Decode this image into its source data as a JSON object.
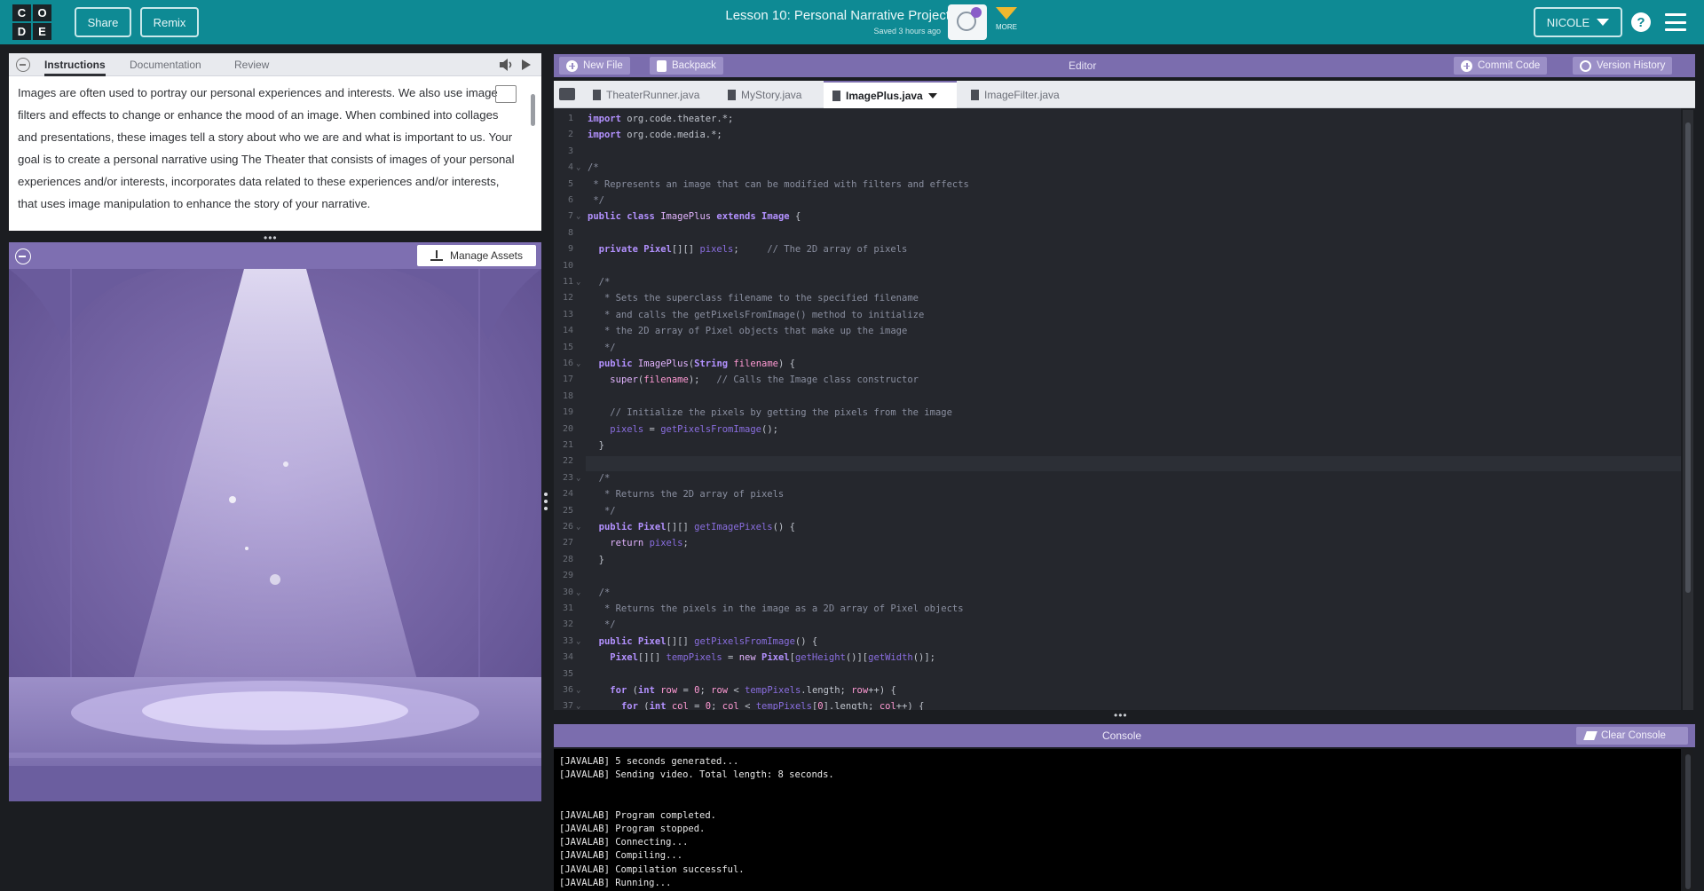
{
  "topbar": {
    "logo_letters": [
      "C",
      "O",
      "D",
      "E"
    ],
    "share_label": "Share",
    "remix_label": "Remix",
    "lesson_title": "Lesson 10: Personal Narrative Project",
    "saved_status": "Saved 3 hours ago",
    "more_label": "MORE",
    "user_name": "NICOLE",
    "help_label": "?"
  },
  "instructions": {
    "tabs": [
      "Instructions",
      "Documentation",
      "Review"
    ],
    "active_tab": "Instructions",
    "text": "Images are often used to portray our personal experiences and interests. We also use image filters and effects to change or enhance the mood of an image. When combined into collages and presentations, these images tell a story about who we are and what is important to us. Your goal is to create a personal narrative using The Theater that consists of images of your personal experiences and/or interests, incorporates data related to these experiences and/or interests, that uses image manipulation to enhance the story of your narrative."
  },
  "theater": {
    "manage_assets_label": "Manage Assets"
  },
  "editor": {
    "new_file_label": "New File",
    "backpack_label": "Backpack",
    "title": "Editor",
    "commit_label": "Commit Code",
    "version_history_label": "Version History",
    "file_tabs": [
      "TheaterRunner.java",
      "MyStory.java",
      "ImagePlus.java",
      "ImageFilter.java"
    ],
    "active_file": "ImagePlus.java",
    "lines": [
      {
        "n": "1",
        "fold": "",
        "html": "<span class='kw'>import</span> org.code.theater.*;"
      },
      {
        "n": "2",
        "fold": "",
        "html": "<span class='kw'>import</span> org.code.media.*;"
      },
      {
        "n": "3",
        "fold": "",
        "html": ""
      },
      {
        "n": "4",
        "fold": "⌄",
        "html": "<span class='cm'>/*</span>"
      },
      {
        "n": "5",
        "fold": "",
        "html": "<span class='cm'> * Represents an image that can be modified with filters and effects</span>"
      },
      {
        "n": "6",
        "fold": "",
        "html": "<span class='cm'> */</span>"
      },
      {
        "n": "7",
        "fold": "⌄",
        "html": "<span class='kw'>public class</span> <span class='ty'>ImagePlus</span> <span class='kw'>extends</span> <span class='kw'>Image</span> {"
      },
      {
        "n": "8",
        "fold": "",
        "html": ""
      },
      {
        "n": "9",
        "fold": "",
        "html": "  <span class='kw'>private Pixel</span>[][] <span class='fn'>pixels</span>;     <span class='cm'>// The 2D array of pixels</span>"
      },
      {
        "n": "10",
        "fold": "",
        "html": ""
      },
      {
        "n": "11",
        "fold": "⌄",
        "html": "  <span class='cm'>/*</span>"
      },
      {
        "n": "12",
        "fold": "",
        "html": "<span class='cm'>   * Sets the superclass filename to the specified filename</span>"
      },
      {
        "n": "13",
        "fold": "",
        "html": "<span class='cm'>   * and calls the getPixelsFromImage() method to initialize</span>"
      },
      {
        "n": "14",
        "fold": "",
        "html": "<span class='cm'>   * the 2D array of Pixel objects that make up the image</span>"
      },
      {
        "n": "15",
        "fold": "",
        "html": "<span class='cm'>   */</span>"
      },
      {
        "n": "16",
        "fold": "⌄",
        "html": "  <span class='kw'>public</span> <span class='ty'>ImagePlus</span>(<span class='kw'>String</span> <span class='st'>filename</span>) {"
      },
      {
        "n": "17",
        "fold": "",
        "html": "    <span class='ty'>super</span>(<span class='st'>filename</span>);   <span class='cm'>// Calls the Image class constructor</span>"
      },
      {
        "n": "18",
        "fold": "",
        "html": ""
      },
      {
        "n": "19",
        "fold": "",
        "html": "    <span class='cm'>// Initialize the pixels by getting the pixels from the image</span>"
      },
      {
        "n": "20",
        "fold": "",
        "html": "    <span class='fn'>pixels</span> = <span class='fn'>getPixelsFromImage</span>();"
      },
      {
        "n": "21",
        "fold": "",
        "html": "  }"
      },
      {
        "n": "22",
        "fold": "",
        "html": ""
      },
      {
        "n": "23",
        "fold": "⌄",
        "html": "  <span class='cm'>/*</span>"
      },
      {
        "n": "24",
        "fold": "",
        "html": "<span class='cm'>   * Returns the 2D array of pixels</span>"
      },
      {
        "n": "25",
        "fold": "",
        "html": "<span class='cm'>   */</span>"
      },
      {
        "n": "26",
        "fold": "⌄",
        "html": "  <span class='kw'>public Pixel</span>[][] <span class='fn'>getImagePixels</span>() {"
      },
      {
        "n": "27",
        "fold": "",
        "html": "    <span class='ty'>return</span> <span class='fn'>pixels</span>;"
      },
      {
        "n": "28",
        "fold": "",
        "html": "  }"
      },
      {
        "n": "29",
        "fold": "",
        "html": ""
      },
      {
        "n": "30",
        "fold": "⌄",
        "html": "  <span class='cm'>/*</span>"
      },
      {
        "n": "31",
        "fold": "",
        "html": "<span class='cm'>   * Returns the pixels in the image as a 2D array of Pixel objects</span>"
      },
      {
        "n": "32",
        "fold": "",
        "html": "<span class='cm'>   */</span>"
      },
      {
        "n": "33",
        "fold": "⌄",
        "html": "  <span class='kw'>public Pixel</span>[][] <span class='fn'>getPixelsFromImage</span>() {"
      },
      {
        "n": "34",
        "fold": "",
        "html": "    <span class='kw'>Pixel</span>[][] <span class='fn'>tempPixels</span> = <span class='ty'>new</span> <span class='kw'>Pixel</span>[<span class='fn'>getHeight</span>()][<span class='fn'>getWidth</span>()];"
      },
      {
        "n": "35",
        "fold": "",
        "html": ""
      },
      {
        "n": "36",
        "fold": "⌄",
        "html": "    <span class='kw'>for</span> (<span class='kw'>int</span> <span class='st'>row</span> = <span class='nm'>0</span>; <span class='st'>row</span> &lt; <span class='fn'>tempPixels</span>.length; <span class='st'>row</span>++) {"
      },
      {
        "n": "37",
        "fold": "⌄",
        "html": "      <span class='kw'>for</span> (<span class='kw'>int</span> <span class='st'>col</span> = <span class='nm'>0</span>; <span class='st'>col</span> &lt; <span class='fn'>tempPixels</span>[<span class='nm'>0</span>].length; <span class='st'>col</span>++) {"
      }
    ]
  },
  "console": {
    "title": "Console",
    "clear_label": "Clear Console",
    "lines": [
      "[JAVALAB] 5 seconds generated...",
      "[JAVALAB] Sending video. Total length: 8 seconds.",
      "",
      "",
      "[JAVALAB] Program completed.",
      "[JAVALAB] Program stopped.",
      "[JAVALAB] Connecting...",
      "[JAVALAB] Compiling...",
      "[JAVALAB] Compilation successful.",
      "[JAVALAB] Running..."
    ]
  },
  "colors": {
    "topbar": "#0e8a94",
    "purple_header": "#7b6dae",
    "code_bg": "#25272d",
    "stage": "#7d6aa8"
  }
}
